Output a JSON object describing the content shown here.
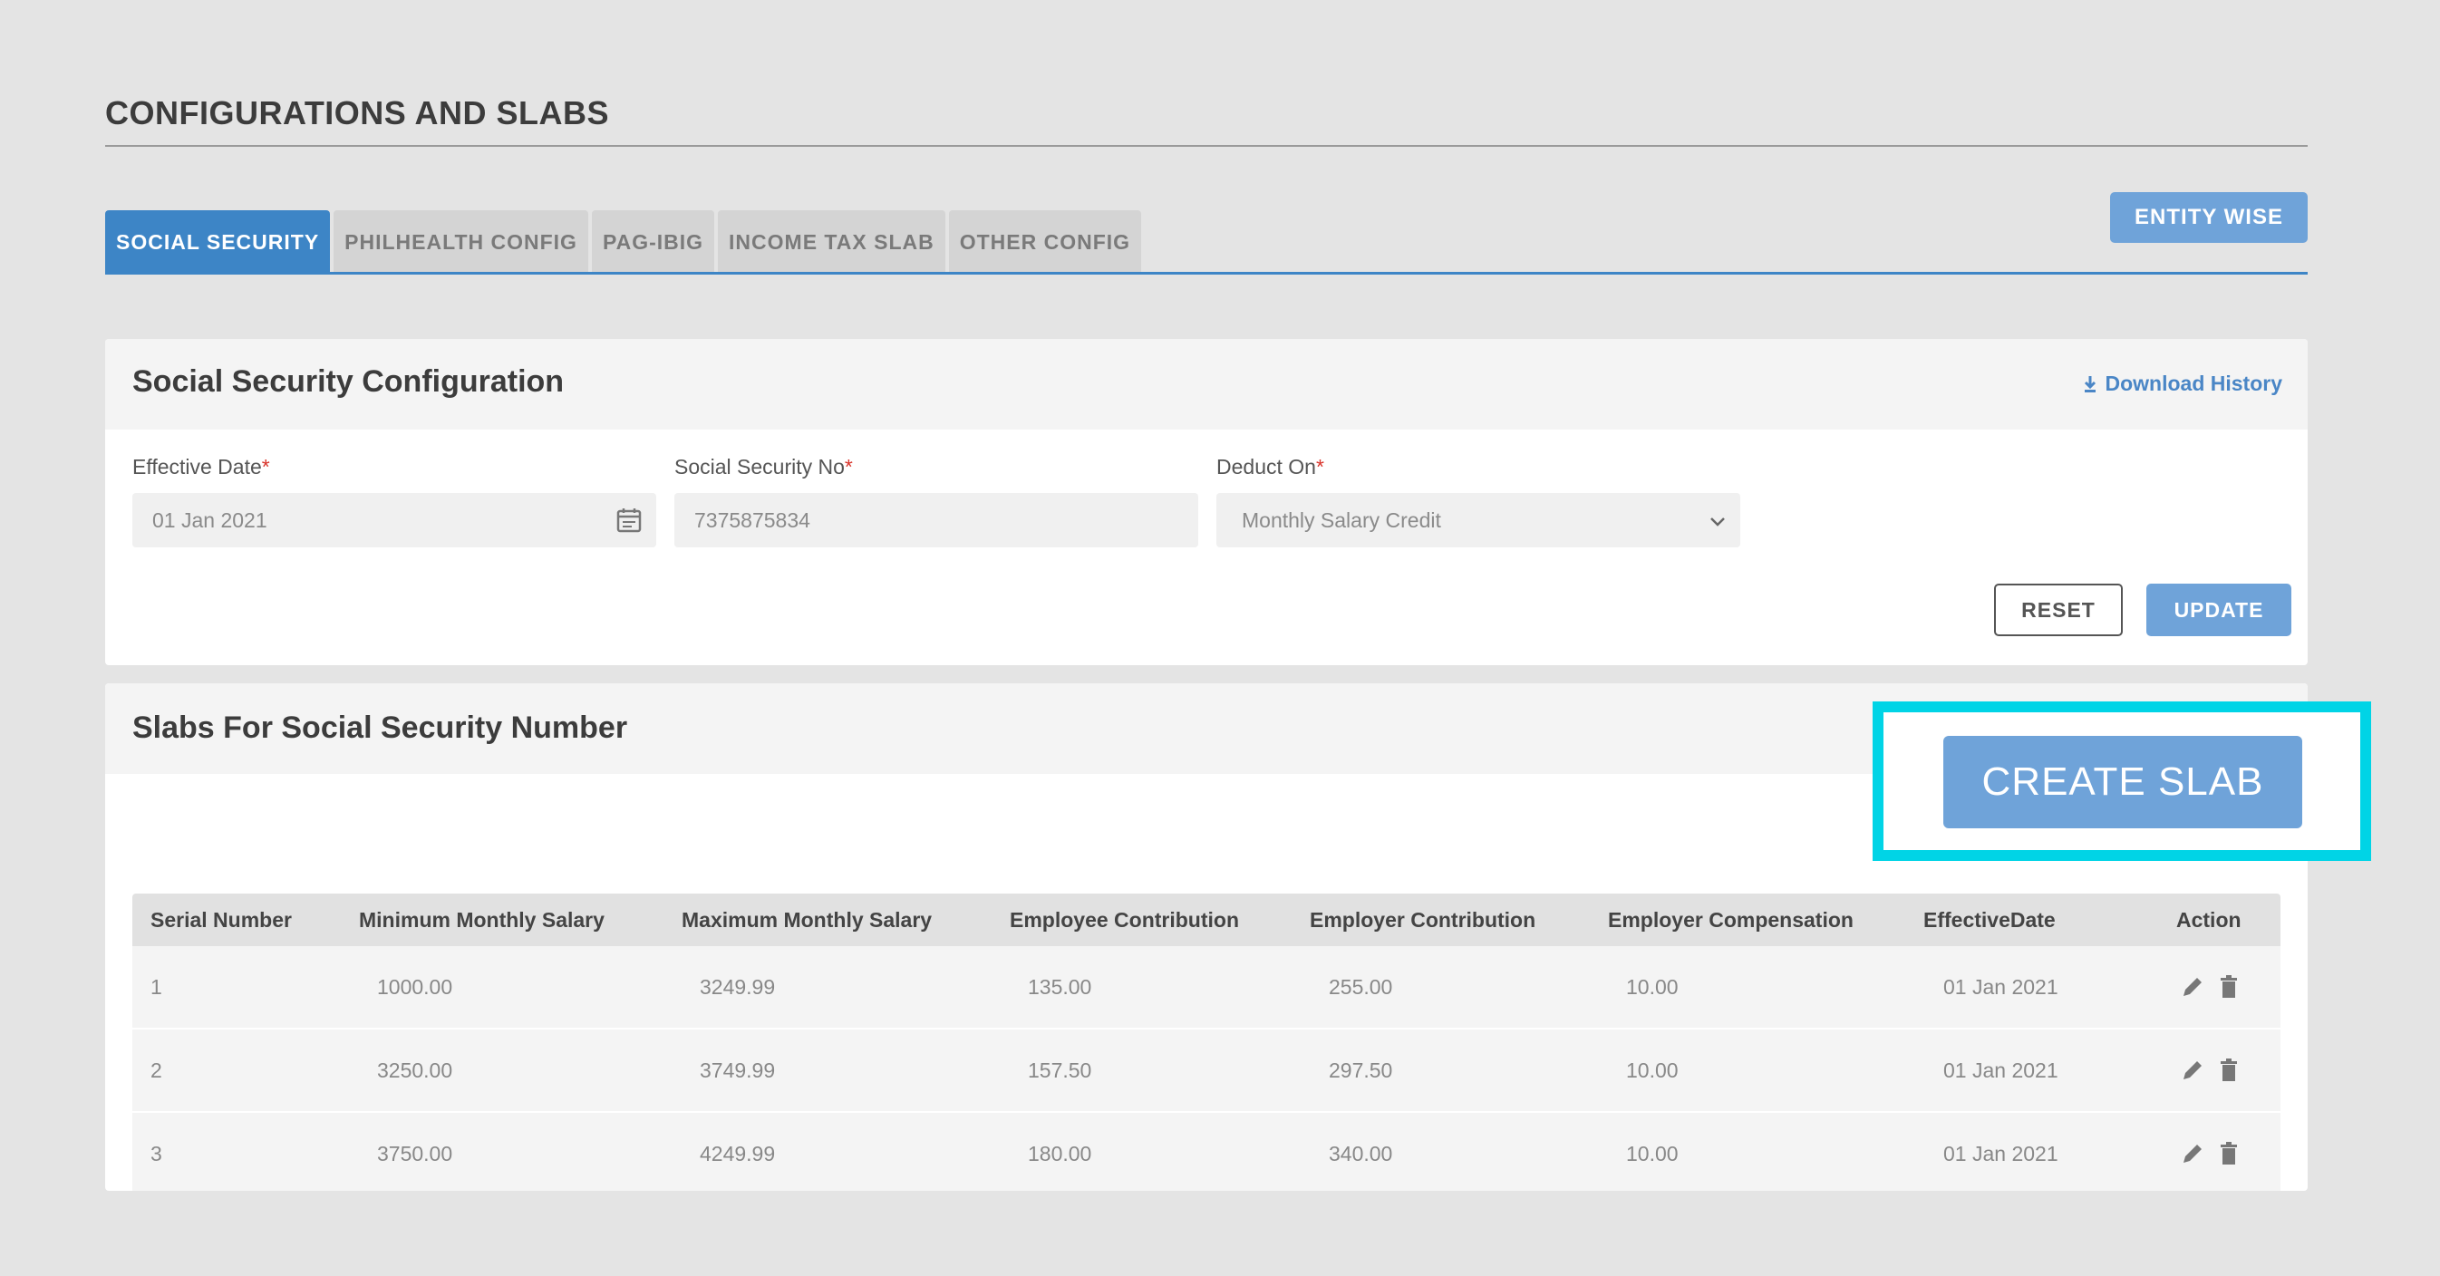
{
  "page": {
    "title": "CONFIGURATIONS AND SLABS"
  },
  "tabs": [
    {
      "label": "SOCIAL SECURITY",
      "active": true
    },
    {
      "label": "PHILHEALTH CONFIG",
      "active": false
    },
    {
      "label": "PAG-IBIG",
      "active": false
    },
    {
      "label": "INCOME TAX SLAB",
      "active": false
    },
    {
      "label": "OTHER CONFIG",
      "active": false
    }
  ],
  "entity_wise_label": "ENTITY WISE",
  "config": {
    "title": "Social Security Configuration",
    "download_label": "Download History",
    "download_icon": "download-icon",
    "effective_date": {
      "label": "Effective Date",
      "required_mark": "*",
      "value": "01 Jan 2021",
      "icon": "calendar-icon"
    },
    "ss_no": {
      "label": "Social Security No",
      "required_mark": "*",
      "value": "7375875834"
    },
    "deduct_on": {
      "label": "Deduct On",
      "required_mark": "*",
      "value": "Monthly Salary Credit",
      "icon": "chevron-down-icon"
    },
    "reset_label": "RESET",
    "update_label": "UPDATE"
  },
  "slabs": {
    "title": "Slabs For Social Security Number",
    "create_label": "CREATE SLAB",
    "columns": [
      "Serial Number",
      "Minimum Monthly Salary",
      "Maximum Monthly Salary",
      "Employee Contribution",
      "Employer Contribution",
      "Employer Compensation",
      "EffectiveDate",
      "Action"
    ],
    "rows": [
      [
        "1",
        "1000.00",
        "3249.99",
        "135.00",
        "255.00",
        "10.00",
        "01 Jan 2021"
      ],
      [
        "2",
        "3250.00",
        "3749.99",
        "157.50",
        "297.50",
        "10.00",
        "01 Jan 2021"
      ],
      [
        "3",
        "3750.00",
        "4249.99",
        "180.00",
        "340.00",
        "10.00",
        "01 Jan 2021"
      ]
    ],
    "action_icons": [
      "pencil-icon",
      "trash-icon"
    ]
  },
  "colors": {
    "accent": "#3d85c6",
    "button_blue": "#6fa3d9",
    "highlight": "#00d4e6",
    "required": "#d9342b"
  }
}
